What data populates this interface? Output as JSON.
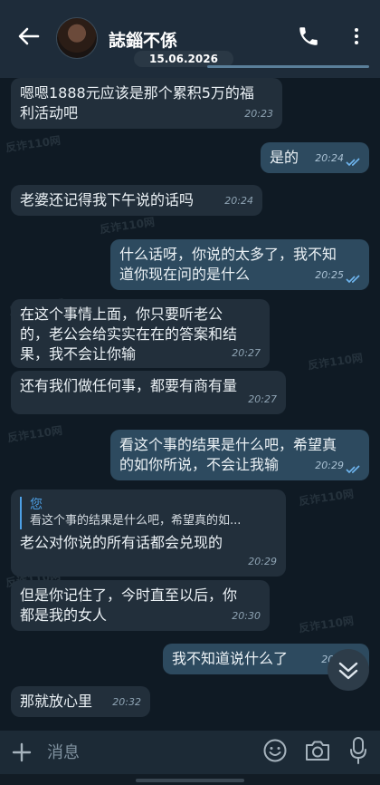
{
  "header": {
    "contact_name": "誌錙不係",
    "back_icon": "arrow-left-icon",
    "call_icon": "phone-icon",
    "menu_icon": "more-vertical-icon"
  },
  "date_pill": "15.06.2026",
  "messages": [
    {
      "dir": "in",
      "text_lines": [
        "嗯嗯1888元应该是那个累积5万的福",
        "利活动吧"
      ],
      "time": "20:23"
    },
    {
      "dir": "out",
      "text_lines": [
        "是的"
      ],
      "time": "20:24"
    },
    {
      "dir": "in",
      "text_lines": [
        "老婆还记得我下午说的话吗"
      ],
      "time": "20:24"
    },
    {
      "dir": "out",
      "text_lines": [
        "什么话呀，你说的太多了，我不知",
        "道你现在问的是什么"
      ],
      "time": "20:25"
    },
    {
      "dir": "in",
      "text_lines": [
        "在这个事情上面，你只要听老公",
        "的，老公会给实实在在的答案和结",
        "果，我不会让你输"
      ],
      "time": "20:27"
    },
    {
      "dir": "in",
      "text_lines": [
        "还有我们做任何事，都要有商有量"
      ],
      "time": "20:27"
    },
    {
      "dir": "out",
      "text_lines": [
        "看这个事的结果是什么吧，希望真",
        "的如你所说，不会让我输"
      ],
      "time": "20:29"
    },
    {
      "dir": "in",
      "quote_name": "您",
      "quote_text": "看这个事的结果是什么吧，希望真的如...",
      "text_lines": [
        "老公对你说的所有话都会兑现的"
      ],
      "time": "20:29"
    },
    {
      "dir": "in",
      "text_lines": [
        "但是你记住了，今时直至以后，你",
        "都是我的女人"
      ],
      "time": "20:30"
    },
    {
      "dir": "out",
      "text_lines": [
        "我不知道说什么了"
      ],
      "time": "20:3"
    },
    {
      "dir": "in",
      "text_lines": [
        "那就放心里"
      ],
      "time": "20:32"
    }
  ],
  "composer": {
    "placeholder": "消息",
    "plus_icon": "plus-icon",
    "emoji_icon": "emoji-icon",
    "camera_icon": "camera-icon",
    "mic_icon": "microphone-icon"
  },
  "watermark": "反诈110网",
  "colors": {
    "background": "#0f1a24",
    "header": "#1e2c3a",
    "incoming": "#222f3b",
    "outgoing": "#2d4a5f",
    "accent": "#4da0e6"
  }
}
